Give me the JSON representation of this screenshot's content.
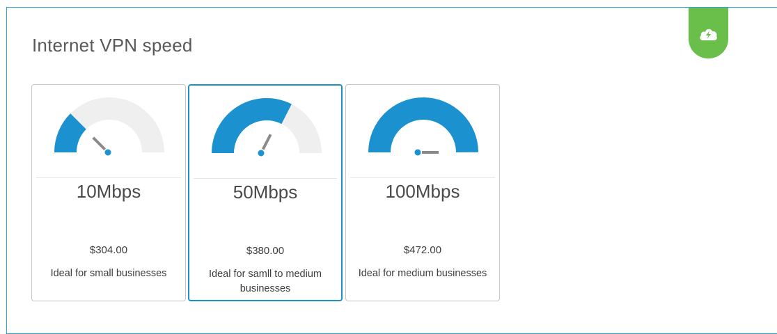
{
  "section": {
    "title": "Internet VPN speed",
    "badge_icon": "cloud-lightning-icon",
    "badge_color": "#6abf4b"
  },
  "accent_color": "#1b91cf",
  "plans": [
    {
      "speed": "10Mbps",
      "price": "$304.00",
      "description": "Ideal for small businesses",
      "selected": false,
      "gauge_level": 0.25
    },
    {
      "speed": "50Mbps",
      "price": "$380.00",
      "description": "Ideal for samll to medium businesses",
      "selected": true,
      "gauge_level": 0.65
    },
    {
      "speed": "100Mbps",
      "price": "$472.00",
      "description": "Ideal for medium businesses",
      "selected": false,
      "gauge_level": 1.0
    }
  ]
}
